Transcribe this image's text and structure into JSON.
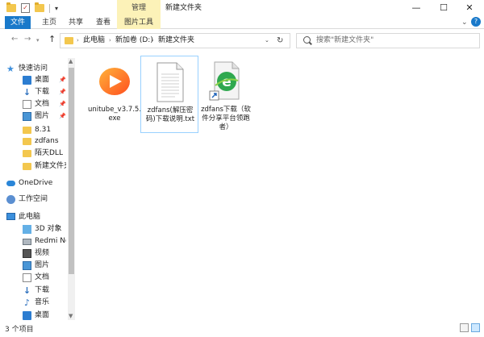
{
  "window": {
    "title": "新建文件夹"
  },
  "ribbon": {
    "context_group": "管理",
    "tabs": [
      "文件",
      "主页",
      "共享",
      "查看",
      "图片工具"
    ]
  },
  "address": {
    "crumbs": [
      "此电脑",
      "新加卷 (D:)",
      "新建文件夹"
    ]
  },
  "search": {
    "placeholder": "搜索\"新建文件夹\""
  },
  "sidebar": {
    "items": [
      {
        "label": "快速访问",
        "icon": "star-icon"
      },
      {
        "label": "桌面",
        "icon": "desktop-icon",
        "pinned": true
      },
      {
        "label": "下载",
        "icon": "download-icon",
        "pinned": true
      },
      {
        "label": "文档",
        "icon": "document-icon",
        "pinned": true
      },
      {
        "label": "图片",
        "icon": "picture-icon",
        "pinned": true
      },
      {
        "label": "8.31",
        "icon": "folder-icon"
      },
      {
        "label": "zdfans",
        "icon": "folder-icon"
      },
      {
        "label": "陌天DLL",
        "icon": "folder-icon"
      },
      {
        "label": "新建文件夹",
        "icon": "folder-icon"
      },
      {
        "label": "OneDrive",
        "icon": "cloud-icon"
      },
      {
        "label": "工作空间",
        "icon": "workspace-icon"
      },
      {
        "label": "此电脑",
        "icon": "computer-icon"
      },
      {
        "label": "3D 对象",
        "icon": "3d-objects-icon"
      },
      {
        "label": "Redmi Note",
        "icon": "phone-drive-icon"
      },
      {
        "label": "视频",
        "icon": "video-icon"
      },
      {
        "label": "图片",
        "icon": "picture-icon"
      },
      {
        "label": "文档",
        "icon": "document-icon"
      },
      {
        "label": "下载",
        "icon": "download-icon"
      },
      {
        "label": "音乐",
        "icon": "music-icon"
      },
      {
        "label": "桌面",
        "icon": "desktop-icon"
      }
    ]
  },
  "files": [
    {
      "name": "unitube_v3.7.5.exe",
      "icon": "unitube-app-icon"
    },
    {
      "name": "zdfans(解压密码)下载说明.txt",
      "icon": "text-file-icon"
    },
    {
      "name": "zdfans下载（软件分享平台领跑者）",
      "icon": "internet-shortcut-icon"
    }
  ],
  "status": {
    "count": "3 个项目"
  },
  "colors": {
    "accent": "#1979ca",
    "context_tab": "#fcf2b8",
    "folder": "#f3c74e",
    "selection_border": "#99d1ff"
  }
}
